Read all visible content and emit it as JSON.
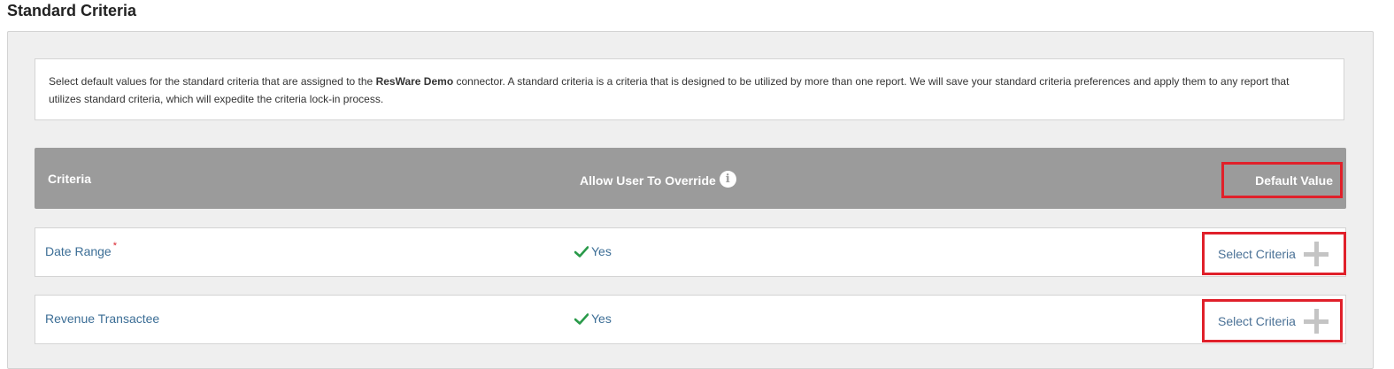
{
  "page": {
    "title": "Standard Criteria"
  },
  "info": {
    "text_before": "Select default values for the standard criteria that are assigned to the ",
    "connector_name": "ResWare Demo",
    "text_after": " connector. A standard criteria is a criteria that is designed to be utilized by more than one report. We will save your standard criteria preferences and apply them to any report that utilizes standard criteria, which will expedite the criteria lock-in process."
  },
  "table": {
    "headers": {
      "criteria": "Criteria",
      "override": "Allow User To Override",
      "default_value": "Default Value"
    },
    "rows": [
      {
        "name": "Date Range",
        "required_marker": "*",
        "override": "Yes",
        "action": "Select Criteria"
      },
      {
        "name": "Revenue Transactee",
        "required_marker": "",
        "override": "Yes",
        "action": "Select Criteria"
      }
    ]
  },
  "icons": {
    "info": "info-icon",
    "check": "check-icon",
    "plus": "plus-icon"
  },
  "colors": {
    "header_bg": "#9b9b9b",
    "link": "#3c6e96",
    "check": "#2a9a4a",
    "highlight": "#e0202a",
    "required": "#d9262f"
  }
}
